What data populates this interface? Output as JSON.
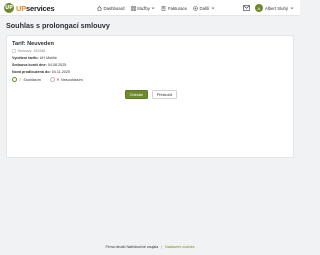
{
  "brand": {
    "logo_mark": "UP",
    "name_prefix": "UP",
    "name_suffix": "services"
  },
  "nav": {
    "items": [
      {
        "label": "Dashboard",
        "icon": "home-icon"
      },
      {
        "label": "Služby",
        "icon": "grid-icon",
        "dropdown": true
      },
      {
        "label": "Fakturace",
        "icon": "invoice-icon"
      },
      {
        "label": "Další",
        "icon": "plus-icon",
        "dropdown": true
      }
    ]
  },
  "user": {
    "initial": "A",
    "name": "Albert Sluhý"
  },
  "page": {
    "title": "Souhlas s prolongací smlouvy"
  },
  "tariff": {
    "title": "Tarif: Neuveden",
    "contract_line": "Smlouvy: 192288",
    "rows": [
      {
        "label": "Vyúčtení tarifu:",
        "value": "UH Mobile"
      },
      {
        "label": "Smlouva končí dne:",
        "value": "04.08.2025"
      },
      {
        "label": "Nová prodloužená do:",
        "value": "04.11.2025"
      }
    ]
  },
  "choices": {
    "agree_label": "Souhlasím",
    "disagree_label": "Nesouhlasím",
    "selected": "agree"
  },
  "actions": {
    "confirm_label": "Odeslat",
    "cancel_label": "Přeskočit"
  },
  "footer": {
    "text": "Firma deutší Nabídnočné zaujala",
    "link": "Nastavení cookies"
  },
  "colors": {
    "accent": "#6d8b2c",
    "brand_orange": "#e78a1e",
    "background": "#f1f2f4"
  }
}
